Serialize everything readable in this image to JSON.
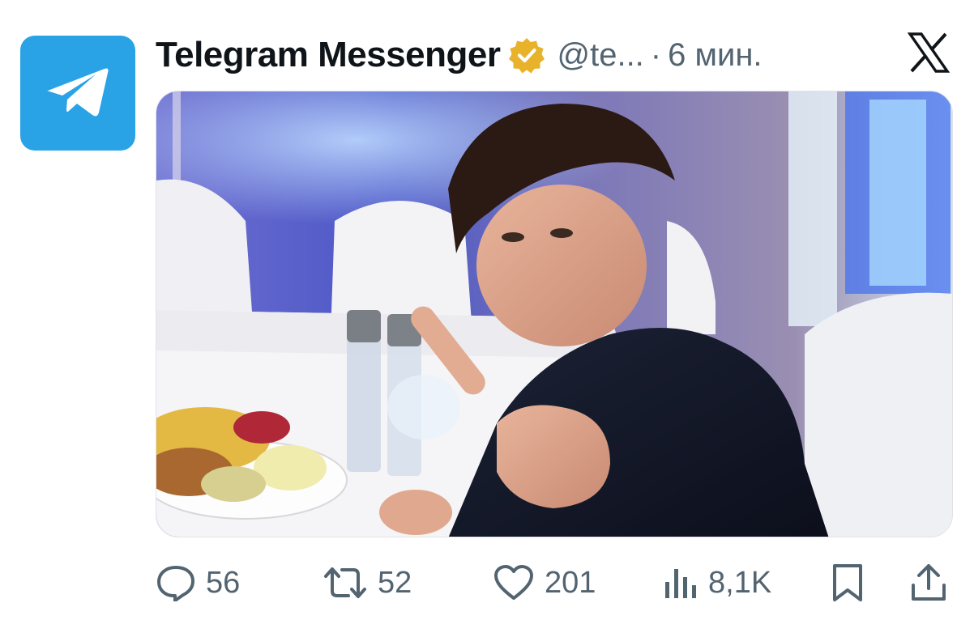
{
  "tweet": {
    "author": {
      "display_name": "Telegram Messenger",
      "handle": "@te...",
      "verified": true,
      "avatar_icon": "telegram-paper-plane-icon",
      "avatar_color": "#2aa3e6"
    },
    "separator": "·",
    "time": "6 мин.",
    "platform_icon": "x-logo-icon",
    "media": {
      "type": "photo",
      "content": "man gesturing toward camera at a banquet table with a plate of food and water bottles"
    },
    "actions": {
      "reply": {
        "icon": "reply-bubble-icon",
        "count": "56"
      },
      "retweet": {
        "icon": "retweet-icon",
        "count": "52"
      },
      "like": {
        "icon": "heart-icon",
        "count": "201"
      },
      "views": {
        "icon": "views-chart-icon",
        "count": "8,1K"
      },
      "bookmark": {
        "icon": "bookmark-icon"
      },
      "share": {
        "icon": "share-upload-icon"
      }
    }
  },
  "colors": {
    "text_primary": "#0f1419",
    "text_secondary": "#536471",
    "verified_gold": "#e8b22b",
    "telegram_blue": "#2aa3e6"
  }
}
